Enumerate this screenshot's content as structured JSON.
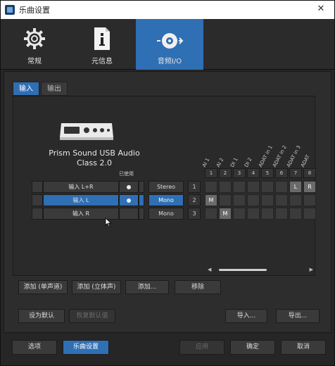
{
  "title": "乐曲设置",
  "toolbar": {
    "items": [
      {
        "label": "常规",
        "icon": "gear-icon"
      },
      {
        "label": "元信息",
        "icon": "info-document-icon"
      },
      {
        "label": "音频I/O",
        "icon": "audio-io-icon",
        "active": true
      }
    ]
  },
  "tabs": [
    {
      "label": "输入",
      "active": true
    },
    {
      "label": "输出",
      "active": false
    }
  ],
  "device": {
    "name_line1": "Prism Sound USB Audio",
    "name_line2": "Class 2.0",
    "used_label": "已使用"
  },
  "channels": [
    {
      "name": "输入 L+R",
      "used": true,
      "selected": false,
      "mode": "Stereo",
      "num": "1"
    },
    {
      "name": "输入 L",
      "used": true,
      "selected": true,
      "mode": "Mono",
      "num": "2"
    },
    {
      "name": "输入 R",
      "used": false,
      "selected": false,
      "mode": "Mono",
      "num": "3"
    }
  ],
  "matrix": {
    "columns": [
      "AI 1",
      "AI 2",
      "DI 1",
      "DI 2",
      "ADAT in 1",
      "ADAT in 2",
      "ADAT in 3",
      "ADAT"
    ],
    "column_numbers": [
      "1",
      "2",
      "3",
      "4",
      "5",
      "6",
      "7",
      "8"
    ],
    "assignments": [
      {
        "row": 0,
        "col": 6,
        "text": "L"
      },
      {
        "row": 0,
        "col": 7,
        "text": "R"
      },
      {
        "row": 1,
        "col": 0,
        "text": "M"
      },
      {
        "row": 2,
        "col": 1,
        "text": "M"
      }
    ]
  },
  "channel_buttons": {
    "add_mono": "添加 (单声道)",
    "add_stereo": "添加 (立体声)",
    "add": "添加...",
    "remove": "移除"
  },
  "preset_buttons": {
    "set_default": "设为默认",
    "restore_default": "恢复默认值",
    "import": "导入...",
    "export": "导出..."
  },
  "footer": {
    "options": "选项",
    "song_setup": "乐曲设置",
    "apply": "应用",
    "ok": "确定",
    "cancel": "取消"
  },
  "colors": {
    "accent": "#2f6fb4",
    "background": "#262626",
    "panel": "#2d2d2d"
  }
}
